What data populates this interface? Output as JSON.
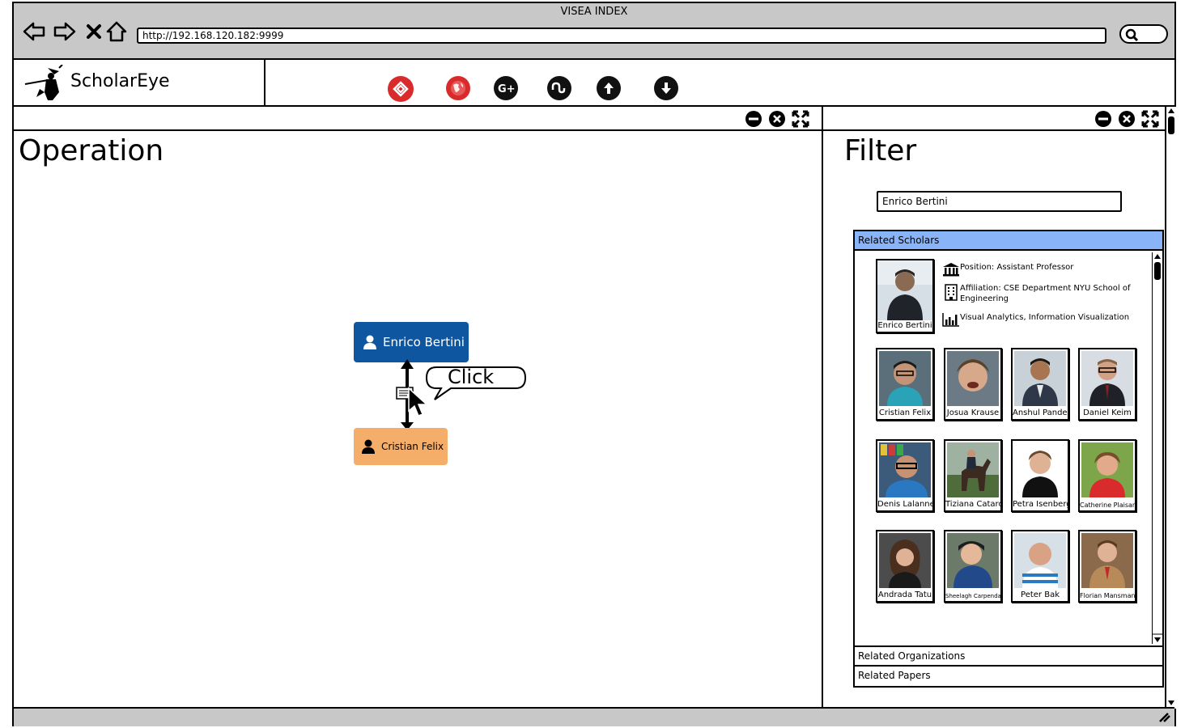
{
  "window": {
    "title": "VISEA INDEX",
    "url": "http://192.168.120.182:9999"
  },
  "app": {
    "name": "ScholarEye"
  },
  "toolbar": {
    "icons": [
      "logo-red-icon",
      "globe-icon",
      "google-plus-icon",
      "stumbleupon-icon",
      "upload-icon",
      "download-icon"
    ],
    "colors": {
      "red": "#d92b2b",
      "dark": "#111111"
    }
  },
  "operation": {
    "title": "Operation",
    "node_top": "Enrico Bertini",
    "node_bottom": "Cristian Felix",
    "callout": "Click",
    "colors": {
      "node_top": "#0f56a0",
      "node_bottom": "#f4ae6a"
    }
  },
  "filter": {
    "title": "Filter",
    "search_value": "Enrico Bertini",
    "sections": {
      "scholars": "Related Scholars",
      "organizations": "Related Organizations",
      "papers": "Related Papers"
    },
    "profile": {
      "name": "Enrico Bertini",
      "position": "Position: Assistant Professor",
      "affiliation": "Affiliation: CSE Department NYU School of Engineering",
      "interests": "Visual Analytics, Information Visualization"
    },
    "scholars": [
      "Cristian Felix",
      "Josua Krause",
      "Anshul Pandey",
      "Daniel Keim",
      "Denis Lalanne",
      "Tiziana Catarci",
      "Petra Isenberg",
      "Catherine Plaisant",
      "Andrada Tatu",
      "Sheelagh Carpendale",
      "Peter Bak",
      "Florian Mansmann"
    ],
    "accent": "#8ab4f8"
  }
}
